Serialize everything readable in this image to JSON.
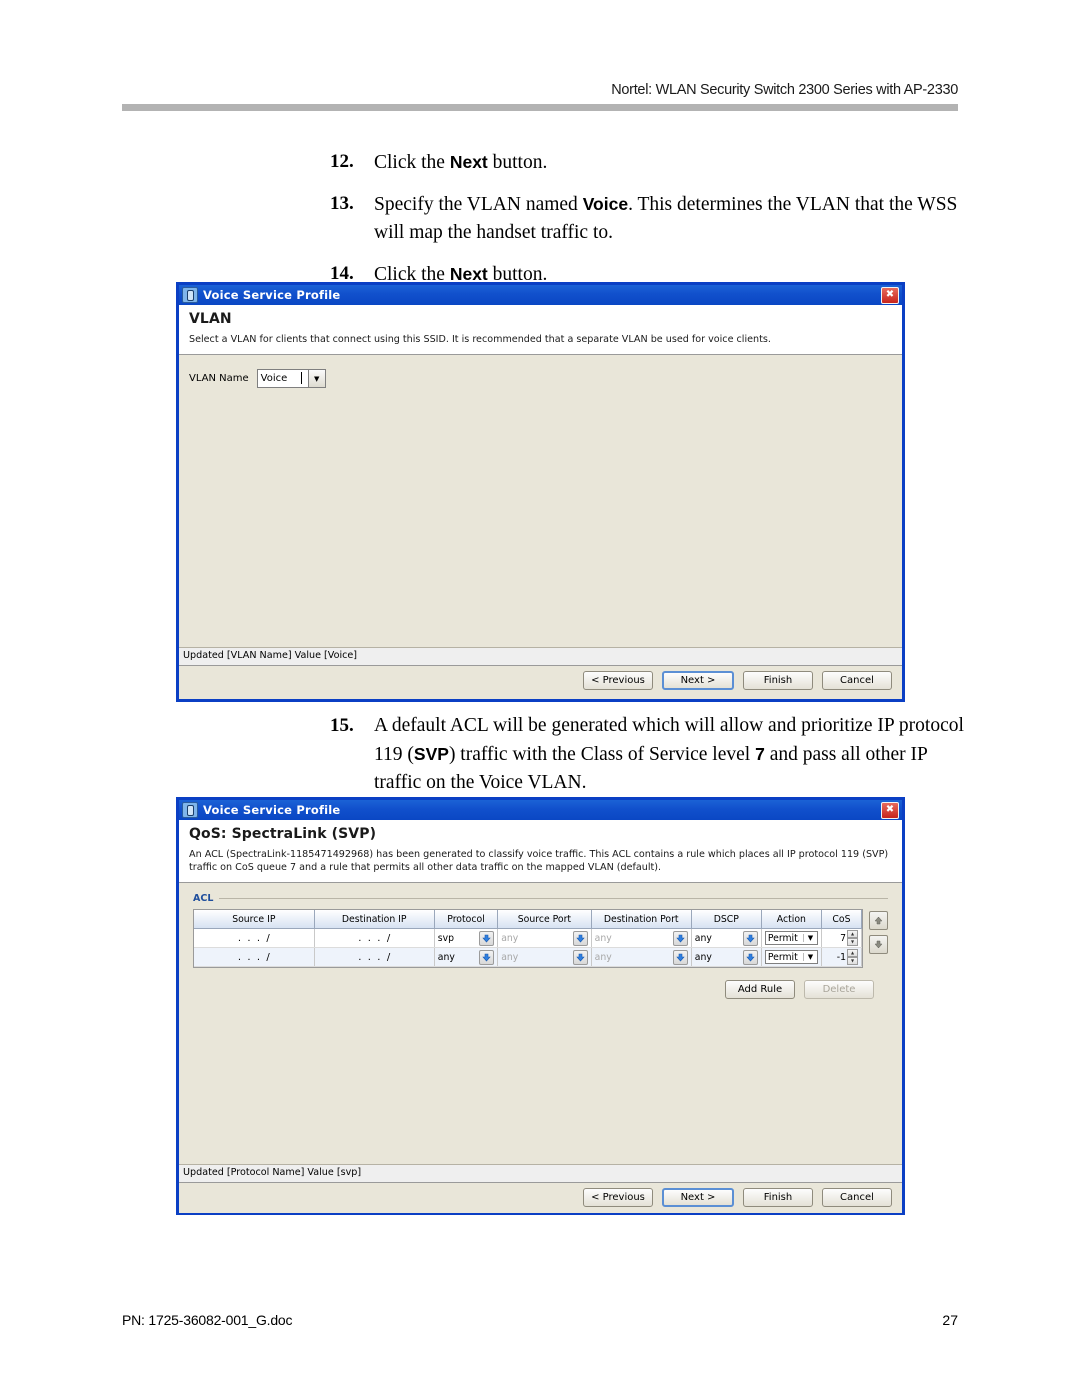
{
  "page": {
    "header": "Nortel: WLAN Security Switch 2300 Series with AP-2330",
    "footer_left": "PN: 1725-36082-001_G.doc",
    "footer_right": "27"
  },
  "steps": [
    {
      "num": "12.",
      "html": "Click the <b>Next</b> button."
    },
    {
      "num": "13.",
      "html": "Specify the VLAN named <b>Voice</b>. This determines the VLAN that the WSS will map the handset traffic to."
    },
    {
      "num": "14.",
      "html": "Click the <b>Next</b> button."
    }
  ],
  "step15": {
    "num": "15.",
    "html": "A default ACL will be generated which will allow and prioritize IP protocol 119 (<b>SVP</b>) traffic with the Class of Service level <b>7</b> and pass all other IP traffic on the Voice VLAN."
  },
  "dialog1": {
    "window_title": "Voice Service Profile",
    "close_label": "✖",
    "title": "VLAN",
    "description": "Select a VLAN for clients that connect using this SSID. It is recommended that a separate VLAN be used for voice clients.",
    "vlan_label": "VLAN Name",
    "vlan_value": "Voice",
    "vlan_placeholder": "Voice",
    "status": "Updated [VLAN Name] Value [Voice]",
    "buttons": {
      "previous": "< Previous",
      "next": "Next >",
      "finish": "Finish",
      "cancel": "Cancel"
    }
  },
  "dialog2": {
    "window_title": "Voice Service Profile",
    "close_label": "✖",
    "title": "QoS: SpectraLink (SVP)",
    "description": "An ACL (SpectraLink-1185471492968) has been generated to classify voice traffic. This ACL contains a rule which places all IP protocol 119 (SVP) traffic on CoS queue 7 and a rule that permits all other data traffic on the mapped VLAN (default).",
    "group_label": "ACL",
    "table": {
      "columns": [
        "Source IP",
        "Destination IP",
        "Protocol",
        "Source Port",
        "Destination Port",
        "DSCP",
        "Action",
        "CoS"
      ],
      "rows": [
        {
          "source_ip": ".  .  .  /",
          "destination_ip": ".  .  .  /",
          "protocol": "svp",
          "source_port": "any",
          "destination_port": "any",
          "dscp": "any",
          "action": "Permit",
          "cos": "7"
        },
        {
          "source_ip": ".  .  .  /",
          "destination_ip": ".  .  .  /",
          "protocol": "any",
          "source_port": "any",
          "destination_port": "any",
          "dscp": "any",
          "action": "Permit",
          "cos": "-1"
        }
      ]
    },
    "add_rule_label": "Add Rule",
    "delete_label": "Delete",
    "status": "Updated [Protocol Name] Value [svp]",
    "buttons": {
      "previous": "< Previous",
      "next": "Next >",
      "finish": "Finish",
      "cancel": "Cancel"
    }
  },
  "colors": {
    "dialog_border": "#0b3fc4",
    "dialog_bg": "#e9e6d9",
    "group_label": "#1f4e9c",
    "arrow_blue": "#2f7fe0",
    "close_red": "#c8241c"
  }
}
